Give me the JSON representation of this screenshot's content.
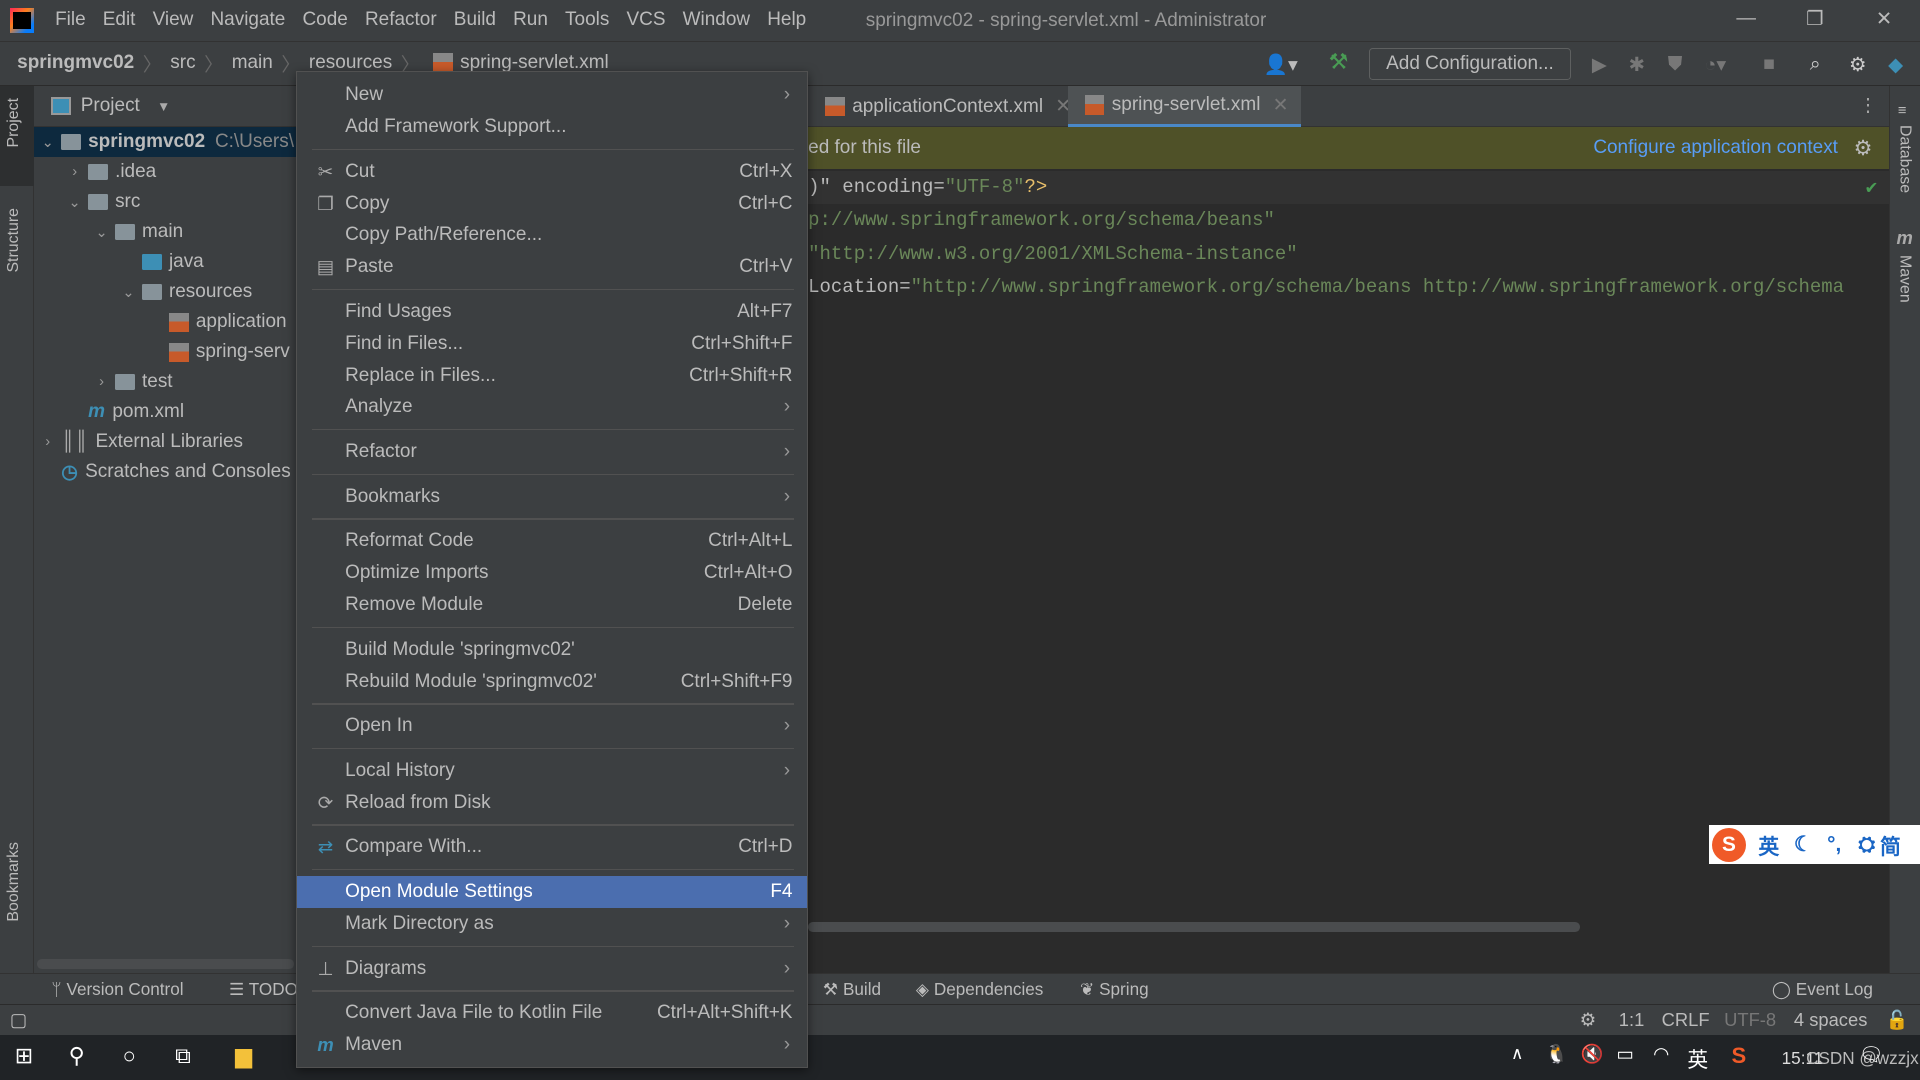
{
  "titlebar": {
    "menus": [
      "File",
      "Edit",
      "View",
      "Navigate",
      "Code",
      "Refactor",
      "Build",
      "Run",
      "Tools",
      "VCS",
      "Window",
      "Help"
    ],
    "title": "springmvc02 - spring-servlet.xml - Administrator"
  },
  "navbar": {
    "crumbs": [
      "springmvc02",
      "src",
      "main",
      "resources",
      "spring-servlet.xml"
    ],
    "add_configuration": "Add Configuration..."
  },
  "left_stripe": {
    "project": "Project",
    "structure": "Structure",
    "bookmarks": "Bookmarks"
  },
  "right_stripe": {
    "database": "Database",
    "maven": "Maven"
  },
  "project_panel": {
    "title": "Project",
    "tree": [
      {
        "label": "springmvc02",
        "extra": "C:\\Users\\",
        "depth": 0,
        "expanded": true,
        "icon": "module-folder-icon",
        "selected": true
      },
      {
        "label": ".idea",
        "depth": 1,
        "expanded": false,
        "icon": "folder-icon"
      },
      {
        "label": "src",
        "depth": 1,
        "expanded": true,
        "icon": "folder-icon"
      },
      {
        "label": "main",
        "depth": 2,
        "expanded": true,
        "icon": "folder-icon"
      },
      {
        "label": "java",
        "depth": 3,
        "icon": "source-folder-icon"
      },
      {
        "label": "resources",
        "depth": 3,
        "expanded": true,
        "icon": "resources-folder-icon"
      },
      {
        "label": "application",
        "depth": 4,
        "icon": "spring-xml-icon"
      },
      {
        "label": "spring-serv",
        "depth": 4,
        "icon": "spring-xml-icon"
      },
      {
        "label": "test",
        "depth": 2,
        "expanded": false,
        "icon": "folder-icon"
      },
      {
        "label": "pom.xml",
        "depth": 1,
        "icon": "maven-icon"
      },
      {
        "label": "External Libraries",
        "depth": 0,
        "expanded": false,
        "icon": "libraries-icon"
      },
      {
        "label": "Scratches and Consoles",
        "depth": 0,
        "icon": "scratches-icon"
      }
    ]
  },
  "editor": {
    "tabs": [
      {
        "label": "applicationContext.xml",
        "active": false
      },
      {
        "label": "spring-servlet.xml",
        "active": true
      }
    ],
    "banner_text": "ed for this file",
    "banner_link": "Configure application context",
    "lines": [
      {
        "a": ")\" encoding=",
        "s": "\"UTF-8\"",
        "p": "?>"
      },
      {
        "a": "",
        "s": "p://www.springframework.org/schema/beans\"",
        "p": ""
      },
      {
        "a": "",
        "s": "\"http://www.w3.org/2001/XMLSchema-instance\"",
        "p": ""
      },
      {
        "a": "Location=",
        "s": "\"http://www.springframework.org/schema/beans http://www.springframework.org/schema",
        "p": ""
      }
    ]
  },
  "context_menu": {
    "items": [
      {
        "label": "New",
        "submenu": true
      },
      {
        "label": "Add Framework Support..."
      },
      {
        "sep": true
      },
      {
        "label": "Cut",
        "shortcut": "Ctrl+X",
        "icon": "scissors-icon",
        "glyph": "✂"
      },
      {
        "label": "Copy",
        "shortcut": "Ctrl+C",
        "icon": "copy-icon",
        "glyph": "❐"
      },
      {
        "label": "Copy Path/Reference..."
      },
      {
        "label": "Paste",
        "shortcut": "Ctrl+V",
        "icon": "paste-icon",
        "glyph": "▤"
      },
      {
        "sep": true
      },
      {
        "label": "Find Usages",
        "shortcut": "Alt+F7"
      },
      {
        "label": "Find in Files...",
        "shortcut": "Ctrl+Shift+F"
      },
      {
        "label": "Replace in Files...",
        "shortcut": "Ctrl+Shift+R"
      },
      {
        "label": "Analyze",
        "submenu": true
      },
      {
        "sep": true
      },
      {
        "label": "Refactor",
        "submenu": true
      },
      {
        "sep": true
      },
      {
        "label": "Bookmarks",
        "submenu": true
      },
      {
        "sep": true
      },
      {
        "label": "Reformat Code",
        "shortcut": "Ctrl+Alt+L"
      },
      {
        "label": "Optimize Imports",
        "shortcut": "Ctrl+Alt+O"
      },
      {
        "label": "Remove Module",
        "shortcut": "Delete"
      },
      {
        "sep": true
      },
      {
        "label": "Build Module 'springmvc02'"
      },
      {
        "label": "Rebuild Module 'springmvc02'",
        "shortcut": "Ctrl+Shift+F9"
      },
      {
        "sep": true
      },
      {
        "label": "Open In",
        "submenu": true
      },
      {
        "sep": true
      },
      {
        "label": "Local History",
        "submenu": true
      },
      {
        "label": "Reload from Disk",
        "icon": "reload-icon",
        "glyph": "⟳"
      },
      {
        "sep": true
      },
      {
        "label": "Compare With...",
        "shortcut": "Ctrl+D",
        "icon": "compare-icon",
        "glyph": "⇄"
      },
      {
        "sep": true
      },
      {
        "label": "Open Module Settings",
        "shortcut": "F4",
        "highlighted": true
      },
      {
        "label": "Mark Directory as",
        "submenu": true
      },
      {
        "sep": true
      },
      {
        "label": "Diagrams",
        "submenu": true,
        "icon": "diagram-icon",
        "glyph": "⊥"
      },
      {
        "sep": true
      },
      {
        "label": "Convert Java File to Kotlin File",
        "shortcut": "Ctrl+Alt+Shift+K"
      },
      {
        "label": "Maven",
        "submenu": true,
        "icon": "maven-icon",
        "glyph": "m"
      }
    ]
  },
  "tool_windows": {
    "version_control": "Version Control",
    "todo": "TODO",
    "build": "Build",
    "dependencies": "Dependencies",
    "spring": "Spring",
    "event_log": "Event Log"
  },
  "status": {
    "position": "1:1",
    "line_sep": "CRLF",
    "encoding": "UTF-8",
    "indent": "4 spaces"
  },
  "ime": {
    "lang": "英",
    "mode": "简"
  },
  "taskbar": {
    "tray_lang": "英",
    "time": "15:11",
    "watermark": "CSDN @wzzjx"
  },
  "colors": {
    "accent": "#4b6eaf",
    "tab_underline": "#4a88c7",
    "banner": "#4f5128",
    "link": "#589df6",
    "string": "#6a8759"
  }
}
